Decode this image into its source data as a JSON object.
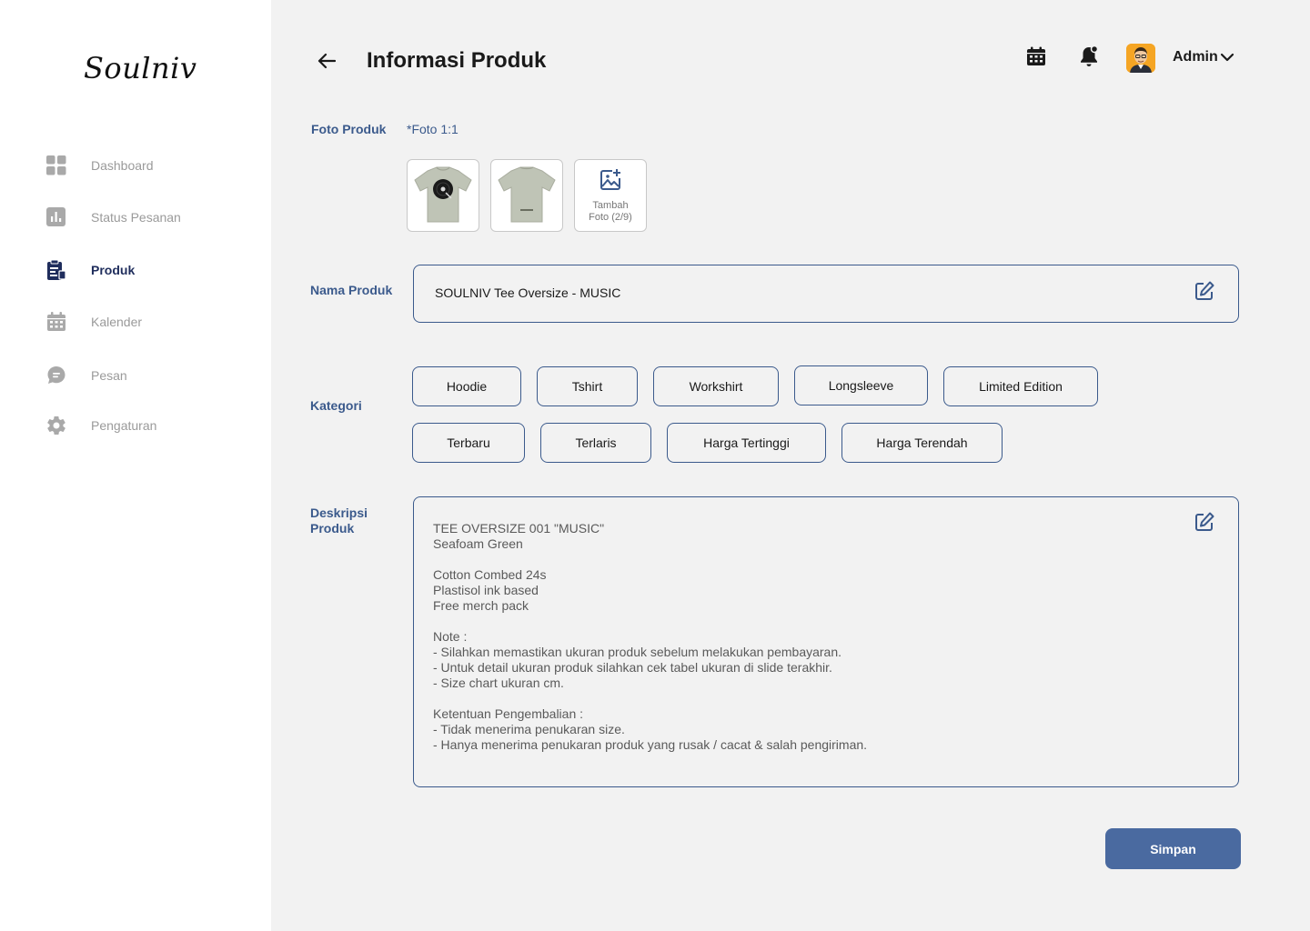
{
  "sidebar": {
    "logo": "Soulniv",
    "items": [
      {
        "label": "Dashboard",
        "icon": "dashboard-grid-icon"
      },
      {
        "label": "Status Pesanan",
        "icon": "bar-chart-icon"
      },
      {
        "label": "Produk",
        "icon": "product-clipboard-icon",
        "active": true
      },
      {
        "label": "Kalender",
        "icon": "calendar-icon"
      },
      {
        "label": "Pesan",
        "icon": "chat-bubble-icon"
      },
      {
        "label": "Pengaturan",
        "icon": "gear-icon"
      }
    ]
  },
  "header": {
    "title": "Informasi Produk",
    "user": "Admin"
  },
  "form": {
    "photo_label": "Foto Produk",
    "photo_note": "*Foto 1:1",
    "add_photo_line1": "Tambah",
    "add_photo_line2": "Foto (2/9)",
    "name_label": "Nama Produk",
    "name_value": "SOULNIV Tee Oversize - MUSIC",
    "category_label": "Kategori",
    "categories": [
      "Hoodie",
      "Tshirt",
      "Workshirt",
      "Longsleeve",
      "Limited Edition",
      "Terbaru",
      "Terlaris",
      "Harga Tertinggi",
      "Harga Terendah"
    ],
    "desc_label_line1": "Deskripsi",
    "desc_label_line2": "Produk",
    "description": "TEE OVERSIZE 001 \"MUSIC\"\nSeafoam Green\n\nCotton Combed 24s\nPlastisol ink based\nFree merch pack\n\nNote :\n- Silahkan memastikan ukuran produk sebelum melakukan pembayaran.\n- Untuk detail ukuran produk silahkan cek tabel ukuran di slide terakhir.\n- Size chart ukuran cm.\n\nKetentuan Pengembalian :\n- Tidak menerima penukaran size.\n- Hanya menerima penukaran produk yang rusak / cacat & salah pengiriman.",
    "save_label": "Simpan"
  },
  "colors": {
    "accent": "#3b5a8c",
    "button": "#4a6aa0",
    "active_nav": "#1f2d5c",
    "background": "#f2f2f2"
  }
}
